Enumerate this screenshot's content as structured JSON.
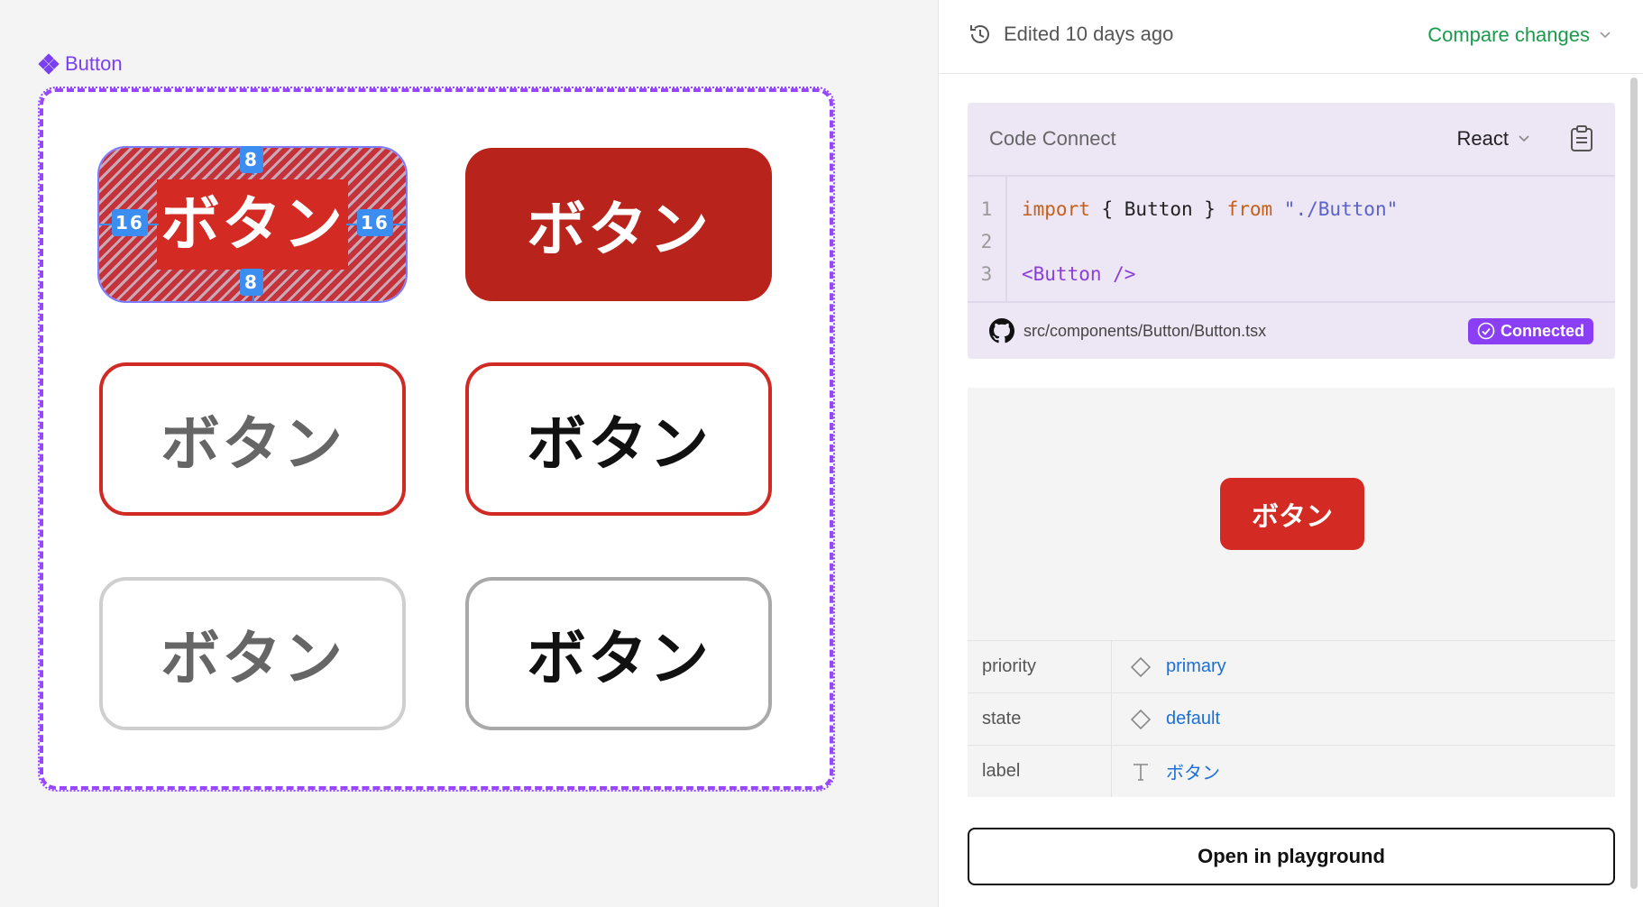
{
  "canvas": {
    "frame_label": "Button",
    "buttons": [
      {
        "label": "ボタン"
      },
      {
        "label": "ボタン"
      },
      {
        "label": "ボタン"
      },
      {
        "label": "ボタン"
      },
      {
        "label": "ボタン"
      },
      {
        "label": "ボタン"
      }
    ],
    "padding": {
      "top": "8",
      "bottom": "8",
      "left": "16",
      "right": "16"
    }
  },
  "header": {
    "history": "Edited 10 days ago",
    "compare": "Compare changes"
  },
  "code_connect": {
    "title": "Code Connect",
    "language": "React",
    "line_numbers": [
      "1",
      "2",
      "3"
    ],
    "code": {
      "import_kw": "import",
      "import_body": " { Button } ",
      "from_kw": "from",
      "path_str": " \"./Button\"",
      "jsx": "<Button />"
    },
    "file_path": "src/components/Button/Button.tsx",
    "status": "Connected"
  },
  "preview": {
    "label": "ボタン"
  },
  "properties": [
    {
      "name": "priority",
      "value": "primary",
      "icon": "variant-diamond-icon"
    },
    {
      "name": "state",
      "value": "default",
      "icon": "variant-diamond-icon"
    },
    {
      "name": "label",
      "value": "ボタン",
      "icon": "text-t-icon"
    }
  ],
  "actions": {
    "playground": "Open in playground"
  },
  "colors": {
    "accent_purple": "#9747ff",
    "primary_red": "#d42a24",
    "dark_red": "#b8231b",
    "link_green": "#1a9b4b",
    "link_blue": "#1b6fd6"
  }
}
